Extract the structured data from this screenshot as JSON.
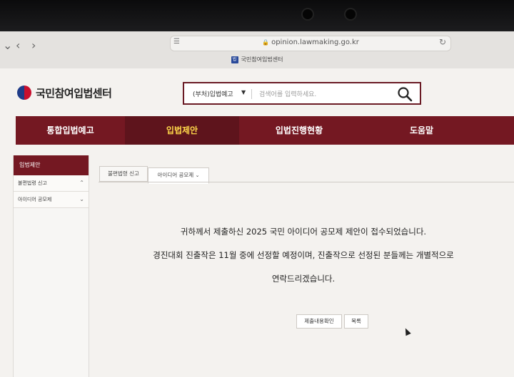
{
  "browser": {
    "url": "opinion.lawmaking.go.kr",
    "tab_title": "국민참여입법센터",
    "favicon_text": "법"
  },
  "site": {
    "logo_text": "국민참여입법센터"
  },
  "search": {
    "category": "(부처)입법예고",
    "placeholder": "검색어를 입력하세요."
  },
  "main_nav": [
    {
      "label": "통합입법예고",
      "active": false
    },
    {
      "label": "입법제안",
      "active": true
    },
    {
      "label": "입법진행현황",
      "active": false
    },
    {
      "label": "도움말",
      "active": false
    }
  ],
  "sidebar": {
    "title": "입법제안",
    "items": [
      {
        "label": "불편법령 신고"
      },
      {
        "label": "아이디어 공모제"
      }
    ]
  },
  "content_tabs": [
    {
      "label": "불편법령 신고"
    },
    {
      "label": "아이디어 공모제"
    }
  ],
  "message": {
    "line1": "귀하께서 제출하신 2025 국민 아이디어 공모제 제안이 접수되었습니다.",
    "line2": "경진대회 진출작은 11월 중에 선정할 예정이며, 진출작으로 선정된 분들께는 개별적으로",
    "line3": "연락드리겠습니다."
  },
  "buttons": {
    "confirm": "제출내용확인",
    "list": "목록"
  },
  "colors": {
    "brand": "#741822",
    "active_nav_text": "#ffd84a"
  }
}
